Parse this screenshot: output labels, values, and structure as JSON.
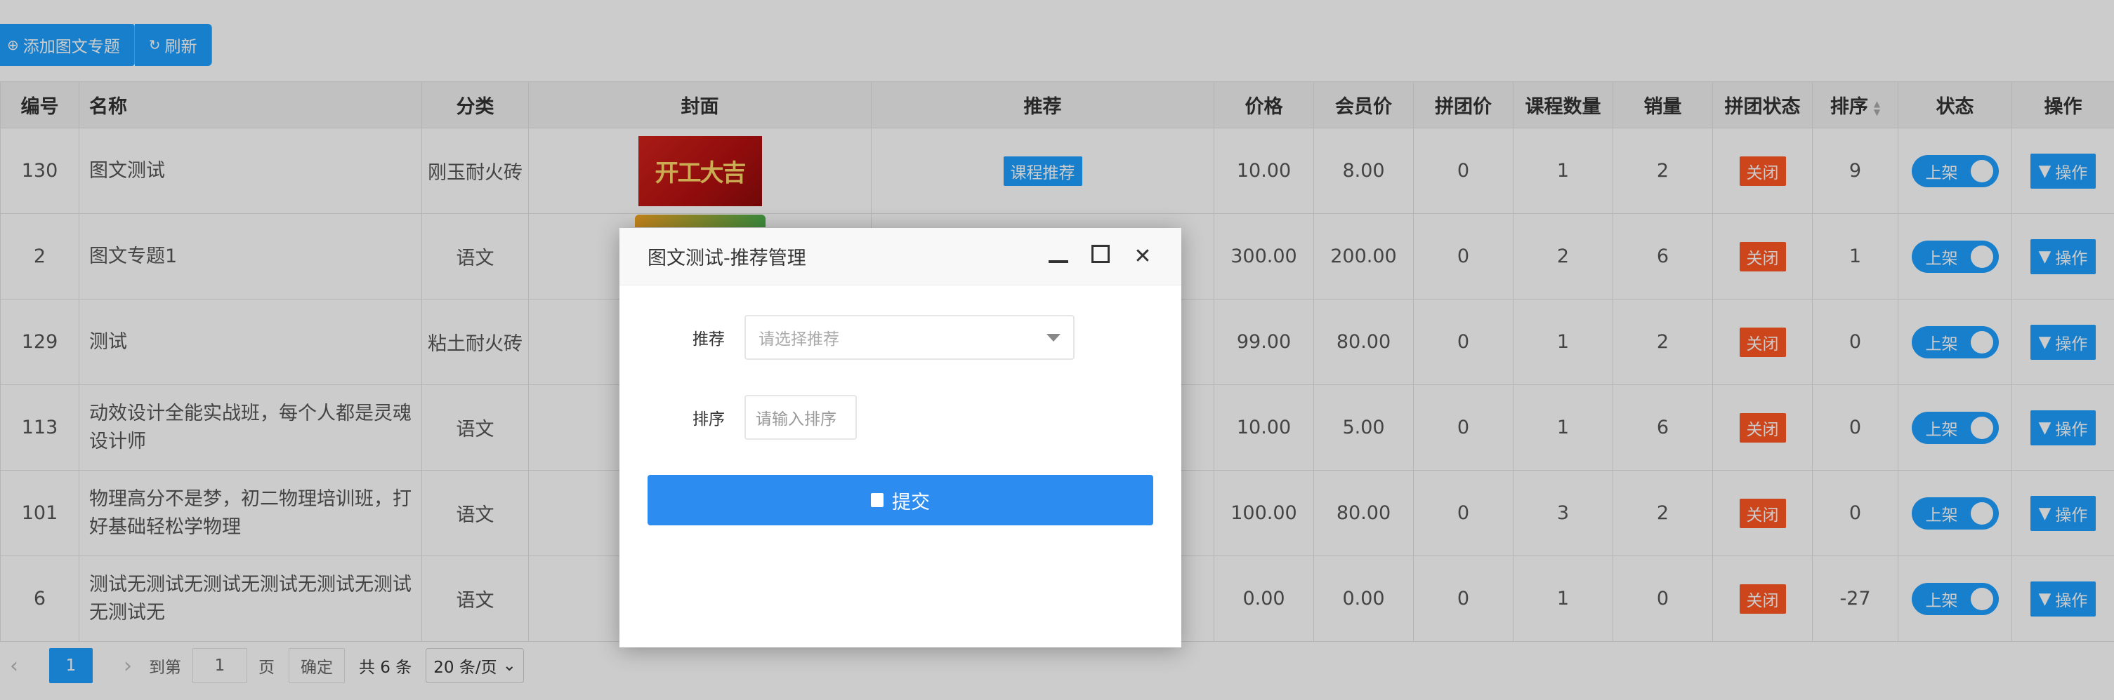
{
  "toolbar": {
    "add_label": "添加图文专题",
    "refresh_label": "刷新"
  },
  "table": {
    "headers": {
      "id": "编号",
      "name": "名称",
      "category": "分类",
      "cover": "封面",
      "recommend": "推荐",
      "price": "价格",
      "member_price": "会员价",
      "group_price": "拼团价",
      "course_count": "课程数量",
      "sales": "销量",
      "group_status": "拼团状态",
      "sort": "排序",
      "status": "状态",
      "ops": "操作"
    },
    "rows": [
      {
        "id": "130",
        "name": "图文测试",
        "category": "刚玉耐火砖",
        "cover_text": "开工大吉",
        "recommend": "课程推荐",
        "price": "10.00",
        "member_price": "8.00",
        "group_price": "0",
        "course_count": "1",
        "sales": "2",
        "group_status": "关闭",
        "sort": "9",
        "status": "上架",
        "ops": "操作"
      },
      {
        "id": "2",
        "name": "图文专题1",
        "category": "语文",
        "cover_text": "",
        "recommend": "",
        "price": "300.00",
        "member_price": "200.00",
        "group_price": "0",
        "course_count": "2",
        "sales": "6",
        "group_status": "关闭",
        "sort": "1",
        "status": "上架",
        "ops": "操作"
      },
      {
        "id": "129",
        "name": "测试",
        "category": "粘土耐火砖",
        "cover_text": "",
        "recommend": "",
        "price": "99.00",
        "member_price": "80.00",
        "group_price": "0",
        "course_count": "1",
        "sales": "2",
        "group_status": "关闭",
        "sort": "0",
        "status": "上架",
        "ops": "操作"
      },
      {
        "id": "113",
        "name": "动效设计全能实战班，每个人都是灵魂设计师",
        "category": "语文",
        "cover_text": "",
        "recommend": "",
        "price": "10.00",
        "member_price": "5.00",
        "group_price": "0",
        "course_count": "1",
        "sales": "6",
        "group_status": "关闭",
        "sort": "0",
        "status": "上架",
        "ops": "操作"
      },
      {
        "id": "101",
        "name": "物理高分不是梦，初二物理培训班，打好基础轻松学物理",
        "category": "语文",
        "cover_text": "",
        "recommend": "",
        "price": "100.00",
        "member_price": "80.00",
        "group_price": "0",
        "course_count": "3",
        "sales": "2",
        "group_status": "关闭",
        "sort": "0",
        "status": "上架",
        "ops": "操作"
      },
      {
        "id": "6",
        "name": "测试无测试无测试无测试无测试无测试无测试无",
        "category": "语文",
        "cover_text": "",
        "recommend": "",
        "price": "0.00",
        "member_price": "0.00",
        "group_price": "0",
        "course_count": "1",
        "sales": "0",
        "group_status": "关闭",
        "sort": "-27",
        "status": "上架",
        "ops": "操作"
      }
    ]
  },
  "pager": {
    "current": "1",
    "goto_label": "到第",
    "goto_value": "1",
    "page_unit": "页",
    "confirm_label": "确定",
    "total": "共 6 条",
    "per_page": "20 条/页"
  },
  "dialog": {
    "title": "图文测试-推荐管理",
    "recommend_label": "推荐",
    "recommend_placeholder": "请选择推荐",
    "sort_label": "排序",
    "sort_placeholder": "请输入排序",
    "submit_label": "提交"
  },
  "colors": {
    "primary": "#1e9fff",
    "danger": "#ff5722",
    "submit": "#2c8cf0"
  }
}
